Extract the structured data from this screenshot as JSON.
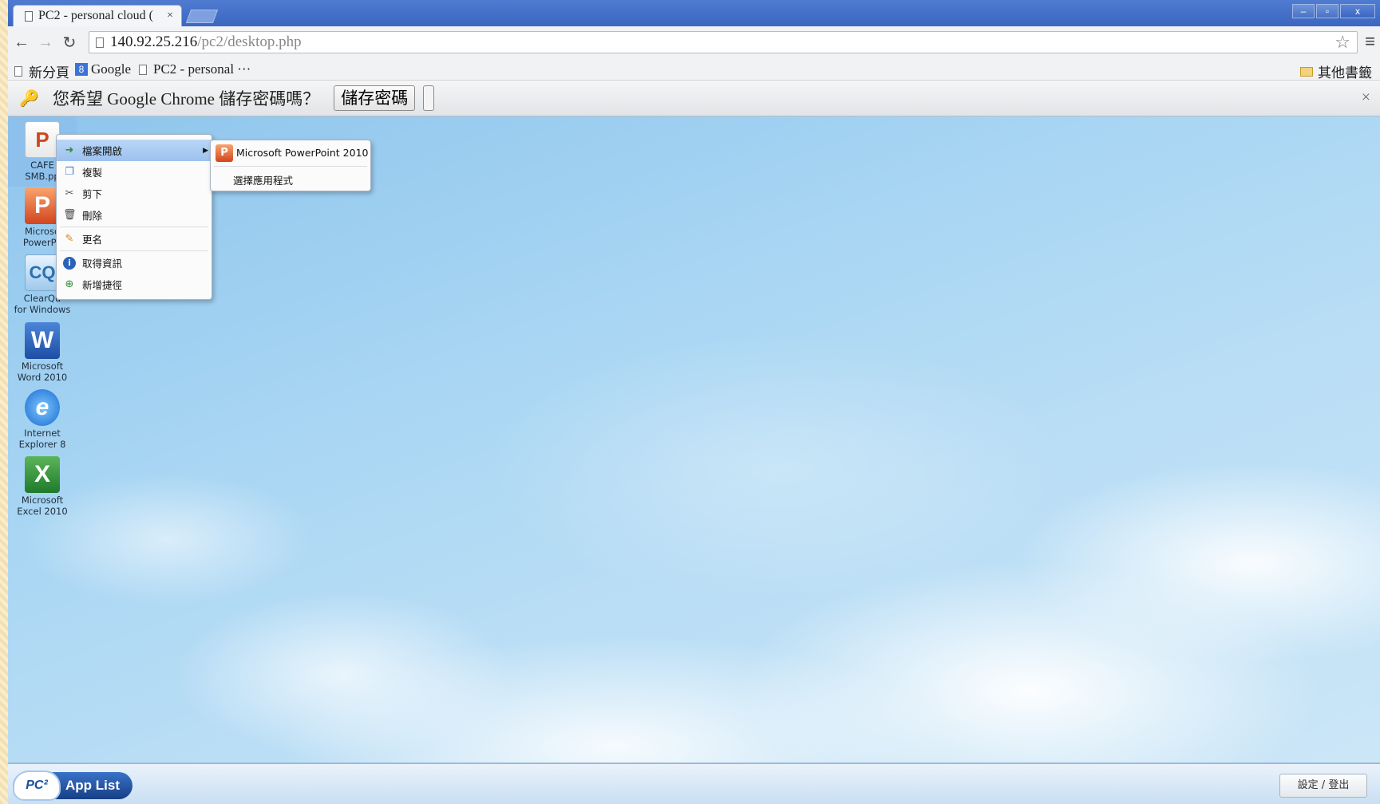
{
  "browser": {
    "tab_title": "PC2 - personal cloud (",
    "tab_close": "×",
    "url_host": "140.92.25.216",
    "url_path": "/pc2/desktop.php",
    "window_controls": [
      "–",
      "▫",
      "x"
    ]
  },
  "bookmarks": {
    "items": [
      {
        "label": "新分頁",
        "icon": "page-icon"
      },
      {
        "label": "Google",
        "icon": "google-icon"
      },
      {
        "label": "PC2 - personal ···",
        "icon": "page-icon"
      }
    ],
    "other": "其他書籤"
  },
  "infobar": {
    "message": "您希望 Google Chrome 儲存密碼嗎？",
    "save_label": "儲存密碼",
    "close": "×"
  },
  "desktop": {
    "icons": [
      {
        "line1": "CAFE",
        "line2": "SMB.pp",
        "glyph": "P",
        "kind": "pptx"
      },
      {
        "line1": "Microso",
        "line2": "PowerPo",
        "glyph": "P",
        "kind": "ppt"
      },
      {
        "line1": "ClearQu",
        "line2": "for Windows",
        "glyph": "CQ",
        "kind": "cq"
      },
      {
        "line1": "Microsoft",
        "line2": "Word 2010",
        "glyph": "W",
        "kind": "word"
      },
      {
        "line1": "Internet",
        "line2": "Explorer 8",
        "glyph": "e",
        "kind": "ie"
      },
      {
        "line1": "Microsoft",
        "line2": "Excel 2010",
        "glyph": "X",
        "kind": "excel"
      }
    ]
  },
  "context_menu": {
    "items": [
      {
        "label": "檔案開啟",
        "icon": "open-icon",
        "has_submenu": true
      },
      {
        "label": "複製",
        "icon": "copy-icon"
      },
      {
        "label": "剪下",
        "icon": "cut-icon"
      },
      {
        "label": "刪除",
        "icon": "trash-icon"
      },
      {
        "label": "更名",
        "icon": "pencil-icon"
      },
      {
        "label": "取得資訊",
        "icon": "info-icon"
      },
      {
        "label": "新增捷徑",
        "icon": "shortcut-icon"
      }
    ],
    "submenu": [
      {
        "label": "Microsoft PowerPoint 2010",
        "icon": "powerpoint-icon"
      },
      {
        "label": "選擇應用程式"
      }
    ]
  },
  "taskbar": {
    "logo": "PC²",
    "applist_label": "App List",
    "settings_label": "設定 / 登出"
  }
}
